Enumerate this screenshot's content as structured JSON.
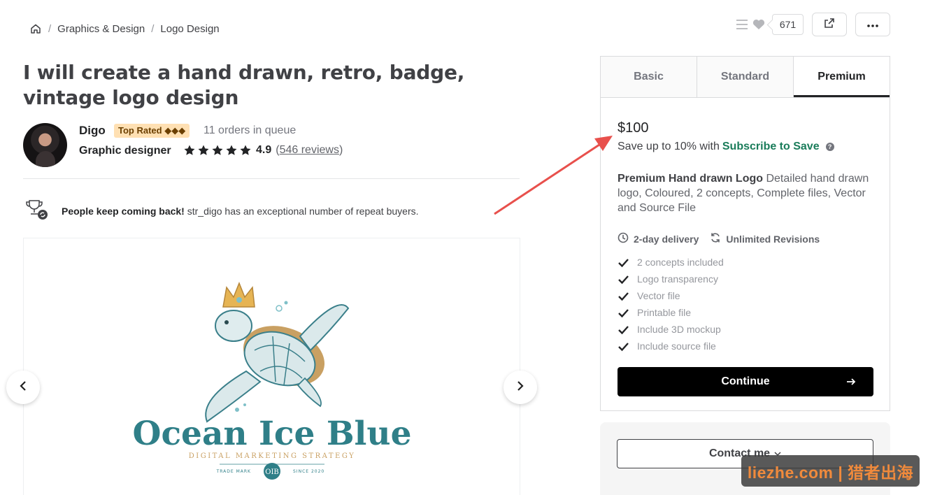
{
  "breadcrumb": {
    "home_icon": "home-icon",
    "items": [
      "Graphics & Design",
      "Logo Design"
    ]
  },
  "top_actions": {
    "list_icon": "list-icon",
    "heart_icon": "heart-icon",
    "likes_count": "671",
    "share_icon": "share-icon",
    "more_icon": "more-icon"
  },
  "gig": {
    "title": "I will create a hand drawn, retro, badge, vintage logo design"
  },
  "seller": {
    "name": "Digo",
    "badge": "Top Rated ◆◆◆",
    "queue": "11 orders in queue",
    "level": "Graphic designer",
    "rating": "4.9",
    "stars": 5,
    "reviews_prefix": "(",
    "reviews_link": "546 reviews",
    "reviews_suffix": ")"
  },
  "repeat_buyers": {
    "strong": "People keep coming back!",
    "text": " str_digo has an exceptional number of repeat buyers."
  },
  "gallery": {
    "image_title": "Ocean Ice Blue",
    "image_subtitle": "DIGITAL MARKETING STRATEGY",
    "image_left": "TRADE MARK",
    "image_monogram": "OIB",
    "image_right": "SINCE 2020",
    "brand_color": "#2f7f88",
    "accent_color": "#c9a062"
  },
  "package": {
    "tabs": [
      "Basic",
      "Standard",
      "Premium"
    ],
    "active_tab": "Premium",
    "price": "$100",
    "save_prefix": "Save up to 10% with ",
    "save_link": "Subscribe to Save",
    "desc_title": "Premium Hand drawn Logo",
    "desc_text": " Detailed hand drawn logo, Coloured, 2 concepts, Complete files, Vector and Source File",
    "delivery": "2-day delivery",
    "revisions": "Unlimited Revisions",
    "features": [
      "2 concepts included",
      "Logo transparency",
      "Vector file",
      "Printable file",
      "Include 3D mockup",
      "Include source file"
    ],
    "continue_label": "Continue"
  },
  "contact": {
    "label": "Contact me"
  },
  "watermark": "liezhe.com | 猎者出海",
  "colors": {
    "annotation_arrow": "#e8504c",
    "subscribe_link": "#1a7c5a",
    "badge_bg": "#ffe0b3"
  }
}
